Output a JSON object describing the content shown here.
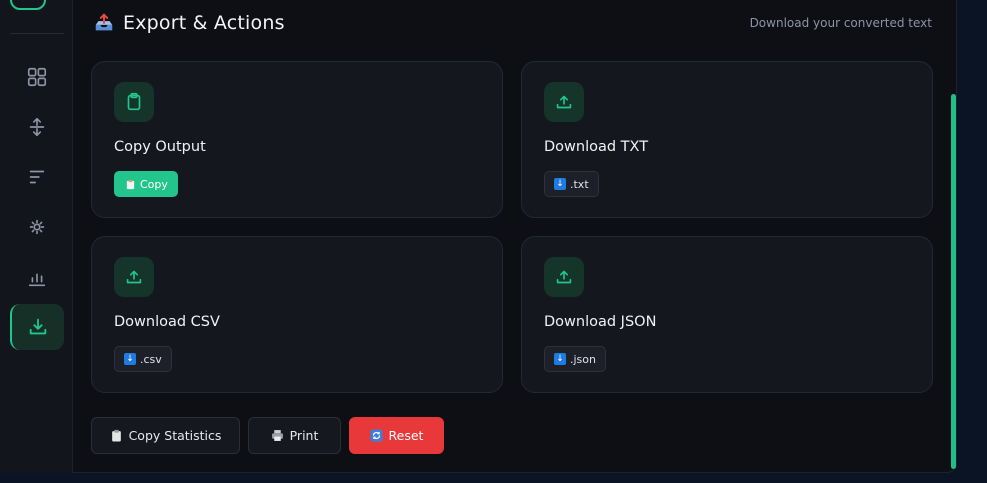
{
  "header": {
    "title": "Export & Actions",
    "subtitle": "Download your converted text",
    "icon": "outbox-tray-icon"
  },
  "sidebar": {
    "items": [
      {
        "icon": "grid-icon",
        "active": false
      },
      {
        "icon": "vertical-arrows-icon",
        "active": false
      },
      {
        "icon": "sort-lines-icon",
        "active": false
      },
      {
        "icon": "gear-icon",
        "active": false
      },
      {
        "icon": "bar-chart-icon",
        "active": false
      },
      {
        "icon": "download-icon",
        "active": true
      }
    ]
  },
  "cards": [
    {
      "title": "Copy Output",
      "icon": "clipboard-icon",
      "action": "Copy",
      "action_glyph": "clipboard-icon",
      "primary": true
    },
    {
      "title": "Download TXT",
      "icon": "upload-icon",
      "action": ".txt",
      "action_glyph": "down-arrow-icon",
      "primary": false
    },
    {
      "title": "Download CSV",
      "icon": "upload-icon",
      "action": ".csv",
      "action_glyph": "down-arrow-icon",
      "primary": false
    },
    {
      "title": "Download JSON",
      "icon": "upload-icon",
      "action": ".json",
      "action_glyph": "down-arrow-icon",
      "primary": false
    }
  ],
  "actions": {
    "copy_stats": "Copy Statistics",
    "print": "Print",
    "reset": "Reset"
  },
  "colors": {
    "accent": "#22c58b",
    "danger": "#e8383a",
    "background": "#0e0f14",
    "card": "#15171e"
  }
}
